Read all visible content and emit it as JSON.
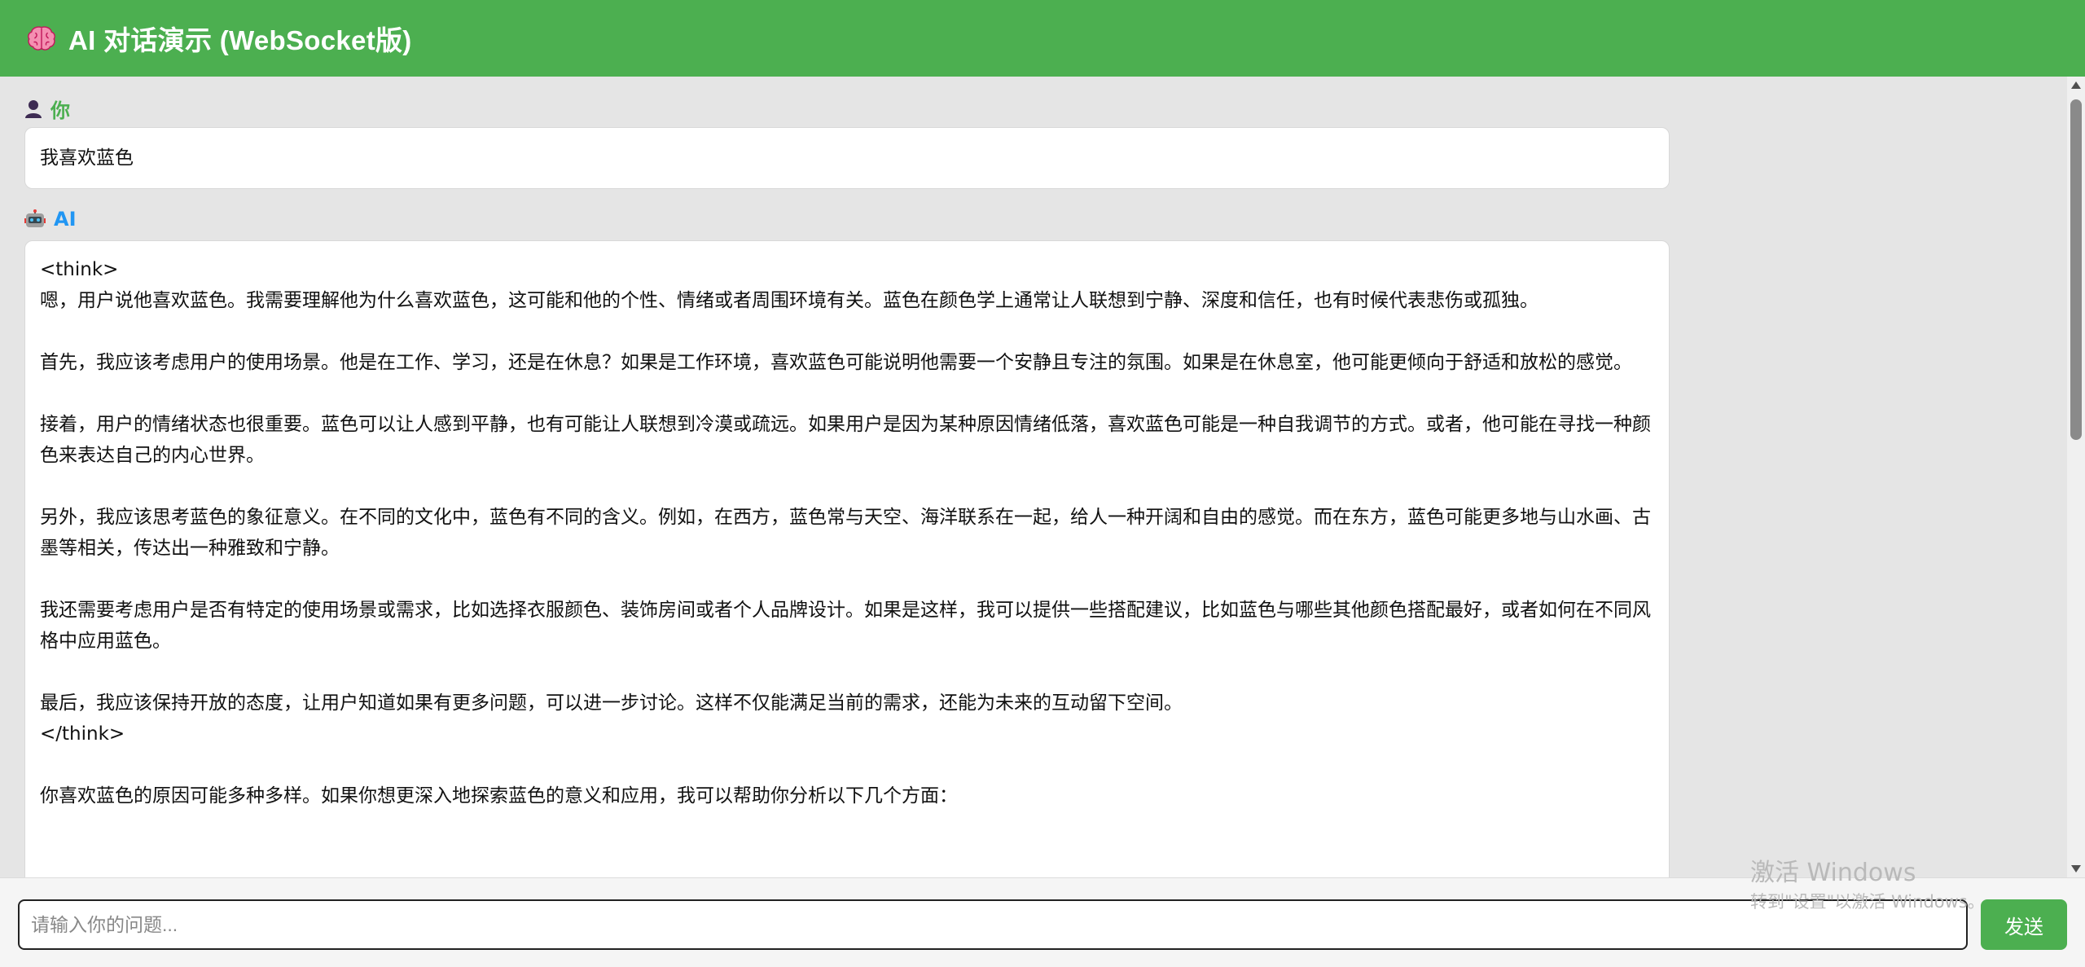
{
  "header": {
    "title": "AI 对话演示 (WebSocket版)",
    "icon": "brain-icon"
  },
  "colors": {
    "header_bg": "#4caf50",
    "user_role": "#4caf50",
    "ai_role": "#2196f3",
    "send_button": "#4caf50"
  },
  "messages": {
    "user": {
      "role_label": "你",
      "icon": "user-icon",
      "text": "我喜欢蓝色"
    },
    "ai": {
      "role_label": "AI",
      "icon": "robot-icon",
      "paragraphs": [
        "<think>\n嗯，用户说他喜欢蓝色。我需要理解他为什么喜欢蓝色，这可能和他的个性、情绪或者周围环境有关。蓝色在颜色学上通常让人联想到宁静、深度和信任，也有时候代表悲伤或孤独。",
        "首先，我应该考虑用户的使用场景。他是在工作、学习，还是在休息？如果是工作环境，喜欢蓝色可能说明他需要一个安静且专注的氛围。如果是在休息室，他可能更倾向于舒适和放松的感觉。",
        "接着，用户的情绪状态也很重要。蓝色可以让人感到平静，也有可能让人联想到冷漠或疏远。如果用户是因为某种原因情绪低落，喜欢蓝色可能是一种自我调节的方式。或者，他可能在寻找一种颜色来表达自己的内心世界。",
        "另外，我应该思考蓝色的象征意义。在不同的文化中，蓝色有不同的含义。例如，在西方，蓝色常与天空、海洋联系在一起，给人一种开阔和自由的感觉。而在东方，蓝色可能更多地与山水画、古墨等相关，传达出一种雅致和宁静。",
        "我还需要考虑用户是否有特定的使用场景或需求，比如选择衣服颜色、装饰房间或者个人品牌设计。如果是这样，我可以提供一些搭配建议，比如蓝色与哪些其他颜色搭配最好，或者如何在不同风格中应用蓝色。",
        "最后，我应该保持开放的态度，让用户知道如果有更多问题，可以进一步讨论。这样不仅能满足当前的需求，还能为未来的互动留下空间。\n</think>",
        "你喜欢蓝色的原因可能多种多样。如果你想更深入地探索蓝色的意义和应用，我可以帮助你分析以下几个方面："
      ]
    }
  },
  "input": {
    "placeholder": "请输入你的问题...",
    "value": ""
  },
  "send_button": {
    "label": "发送"
  },
  "watermark": {
    "title": "激活 Windows",
    "subtitle": "转到\"设置\"以激活 Windows。"
  }
}
